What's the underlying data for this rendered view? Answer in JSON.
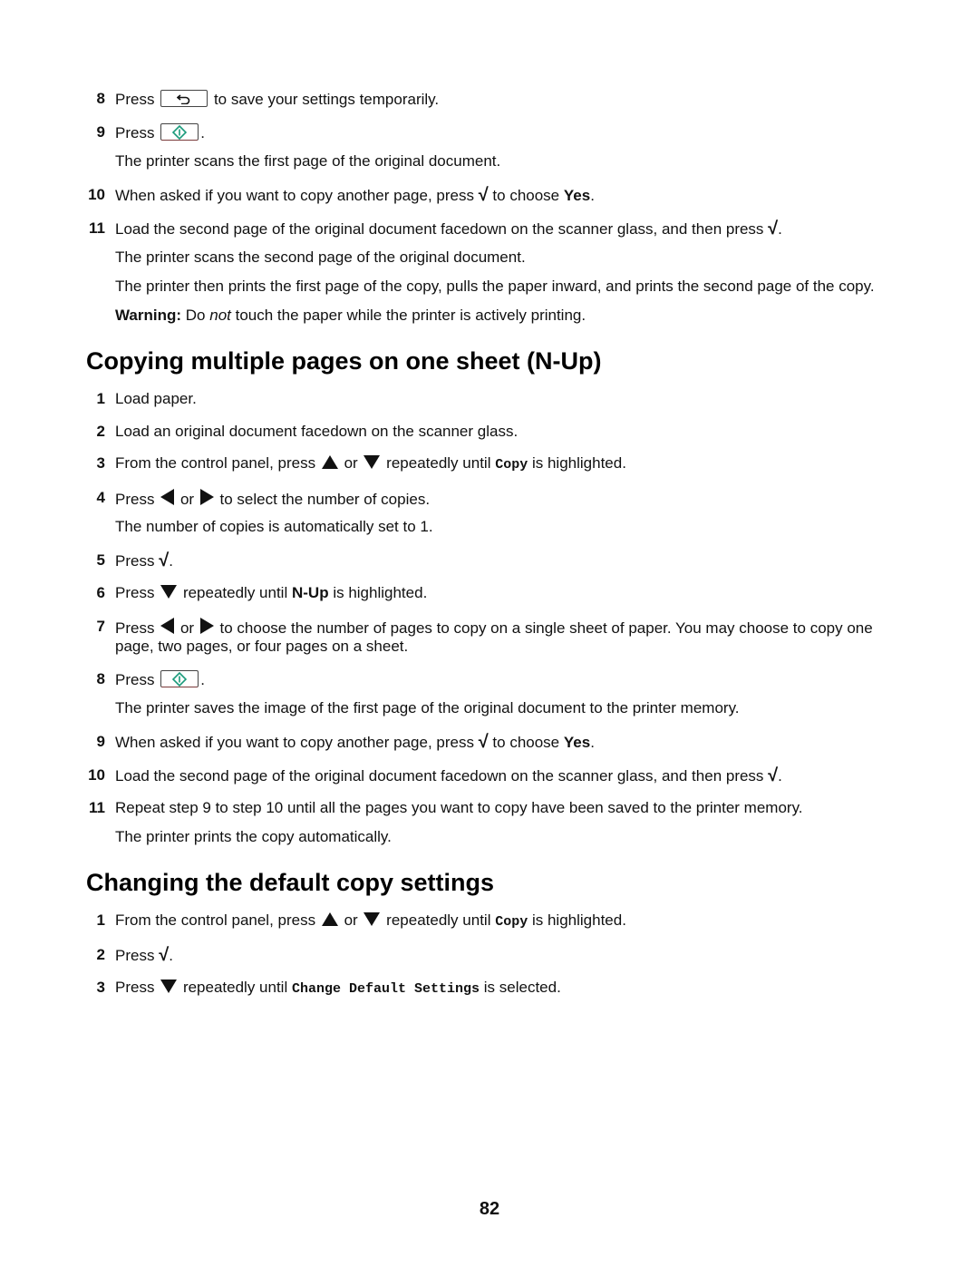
{
  "section_prev": {
    "steps": [
      {
        "num": "8",
        "parts": [
          "Press",
          "to save your settings temporarily."
        ],
        "icon": "back-key-icon"
      },
      {
        "num": "9",
        "parts": [
          "Press",
          "."
        ],
        "icon": "start-key-icon",
        "note": "The printer scans the first page of the original document."
      },
      {
        "num": "10",
        "parts": [
          "When asked if you want to copy another page, press",
          "to choose",
          "Yes",
          "."
        ]
      },
      {
        "num": "11",
        "parts": [
          "Load the second page of the original document facedown on the scanner glass, and then press",
          "."
        ],
        "notes": [
          "The printer scans the second page of the original document.",
          "The printer then prints the first page of the copy, pulls the paper inward, and prints the second page of the copy."
        ]
      }
    ],
    "warning": {
      "label": "Warning:",
      "pre": "Do",
      "emph": "not",
      "post": "touch the paper while the printer is actively printing."
    }
  },
  "section_nup": {
    "title": "Copying multiple pages on one sheet (N-Up)",
    "steps": [
      {
        "num": "1",
        "text": "Load paper."
      },
      {
        "num": "2",
        "text": "Load an original document facedown on the scanner glass."
      },
      {
        "num": "3",
        "parts": [
          "From the control panel, press",
          "or",
          "repeatedly until",
          "Copy",
          "is highlighted."
        ]
      },
      {
        "num": "4",
        "parts": [
          "Press",
          "or",
          "to select the number of copies."
        ],
        "note": "The number of copies is automatically set to 1."
      },
      {
        "num": "5",
        "parts": [
          "Press",
          "."
        ]
      },
      {
        "num": "6",
        "parts": [
          "Press",
          "repeatedly until",
          "N-Up",
          "is highlighted."
        ]
      },
      {
        "num": "7",
        "parts": [
          "Press",
          "or",
          "to choose the number of pages to copy on a single sheet of paper. You may choose to copy one",
          "page, two pages, or four pages on a sheet."
        ]
      },
      {
        "num": "8",
        "parts": [
          "Press",
          "."
        ],
        "note": "The printer saves the image of the first page of the original document to the printer memory."
      },
      {
        "num": "9",
        "parts": [
          "When asked if you want to copy another page, press",
          "to choose",
          "Yes",
          "."
        ]
      },
      {
        "num": "10",
        "parts": [
          "Load the second page of the original document facedown on the scanner glass, and then press",
          "."
        ]
      },
      {
        "num": "11",
        "text": "Repeat step 9 to step 10 until all the pages you want to copy have been saved to the printer memory.",
        "note": "The printer prints the copy automatically."
      }
    ]
  },
  "section_default": {
    "title": "Changing the default copy settings",
    "steps": [
      {
        "num": "1",
        "parts": [
          "From the control panel, press",
          "or",
          "repeatedly until",
          "Copy",
          "is highlighted."
        ]
      },
      {
        "num": "2",
        "parts": [
          "Press",
          "."
        ]
      },
      {
        "num": "3",
        "parts": [
          "Press",
          "repeatedly until",
          "Change Default Settings",
          "is selected."
        ]
      }
    ]
  },
  "colors": {
    "start_key_accent": "#1a9a7a"
  },
  "page_number": "82"
}
